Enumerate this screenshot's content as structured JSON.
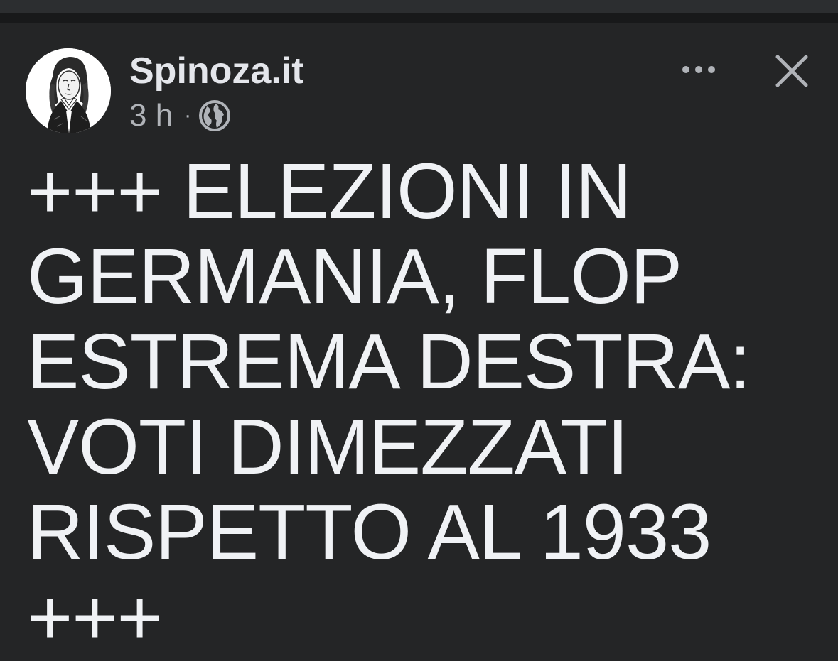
{
  "post": {
    "page_name": "Spinoza.it",
    "timestamp": "3 h",
    "separator": "·",
    "audience_icon": "globe-icon",
    "more_icon": "more-horizontal-icon",
    "close_icon": "close-icon",
    "text": "+++ ELEZIONI IN GERMANIA, FLOP ESTREMA DESTRA: VOTI DIMEZZATI RISPETTO AL 1933 +++"
  },
  "colors": {
    "background": "#242526",
    "primary_text": "#e4e6eb",
    "secondary_text": "#b0b3b8"
  }
}
